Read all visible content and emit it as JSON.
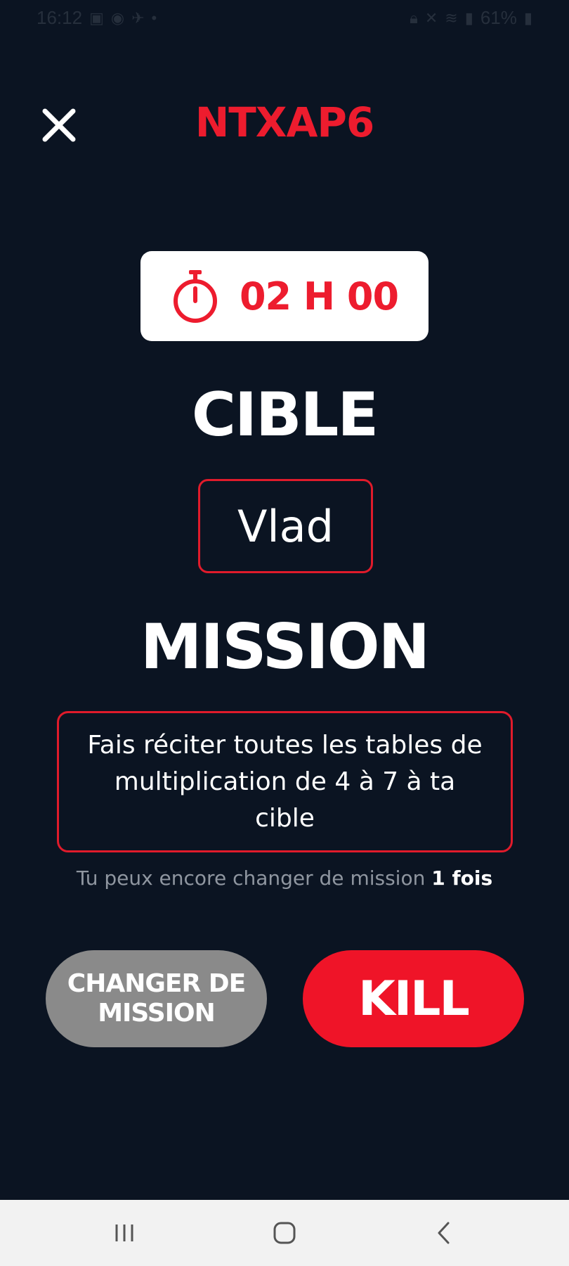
{
  "status_bar": {
    "time": "16:12",
    "battery": "61%"
  },
  "header": {
    "room_code": "NTXAP6"
  },
  "timer": {
    "value": "02 H 00"
  },
  "target": {
    "title": "CIBLE",
    "name": "Vlad"
  },
  "mission": {
    "title": "MISSION",
    "text": "Fais réciter toutes les tables de multiplication de 4 à 7 à ta cible",
    "change_note_prefix": "Tu peux encore changer de mission",
    "change_note_count": "1 fois"
  },
  "buttons": {
    "change_label": "CHANGER DE MISSION",
    "kill_label": "KILL"
  },
  "icons": {
    "close": "close-icon",
    "timer": "stopwatch-icon",
    "recent": "recent-apps-icon",
    "home": "home-icon",
    "back": "back-icon"
  },
  "colors": {
    "background": "#0b1422",
    "accent_red": "#ed1c2e",
    "change_button": "#8a8a8a",
    "white": "#ffffff",
    "muted_text": "#8f96a0"
  }
}
